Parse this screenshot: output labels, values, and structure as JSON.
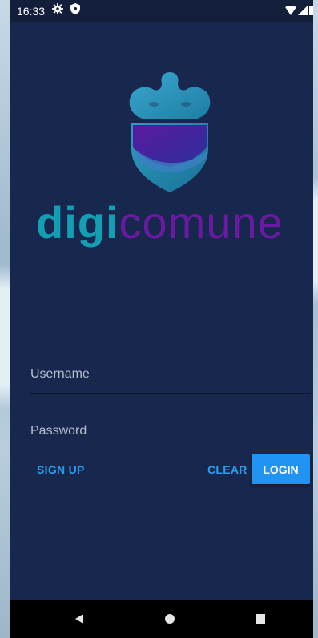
{
  "status_bar": {
    "time": "16:33",
    "left_icons": [
      "gear-icon",
      "shield-icon"
    ],
    "right_icons": [
      "wifi-icon",
      "signal-icon",
      "battery-icon"
    ]
  },
  "brand": {
    "name_part1": "digi",
    "name_part2": "comune",
    "colors": {
      "part1": "#139eb3",
      "part2": "#6a1aa0"
    }
  },
  "form": {
    "username_placeholder": "Username",
    "username_value": "",
    "password_placeholder": "Password",
    "password_value": ""
  },
  "actions": {
    "signup_label": "SIGN UP",
    "clear_label": "CLEAR",
    "login_label": "LOGIN"
  },
  "nav_bar": {
    "buttons": [
      "back-icon",
      "home-icon",
      "recents-icon"
    ]
  },
  "colors": {
    "background": "#17274d",
    "accent": "#2193f3"
  }
}
